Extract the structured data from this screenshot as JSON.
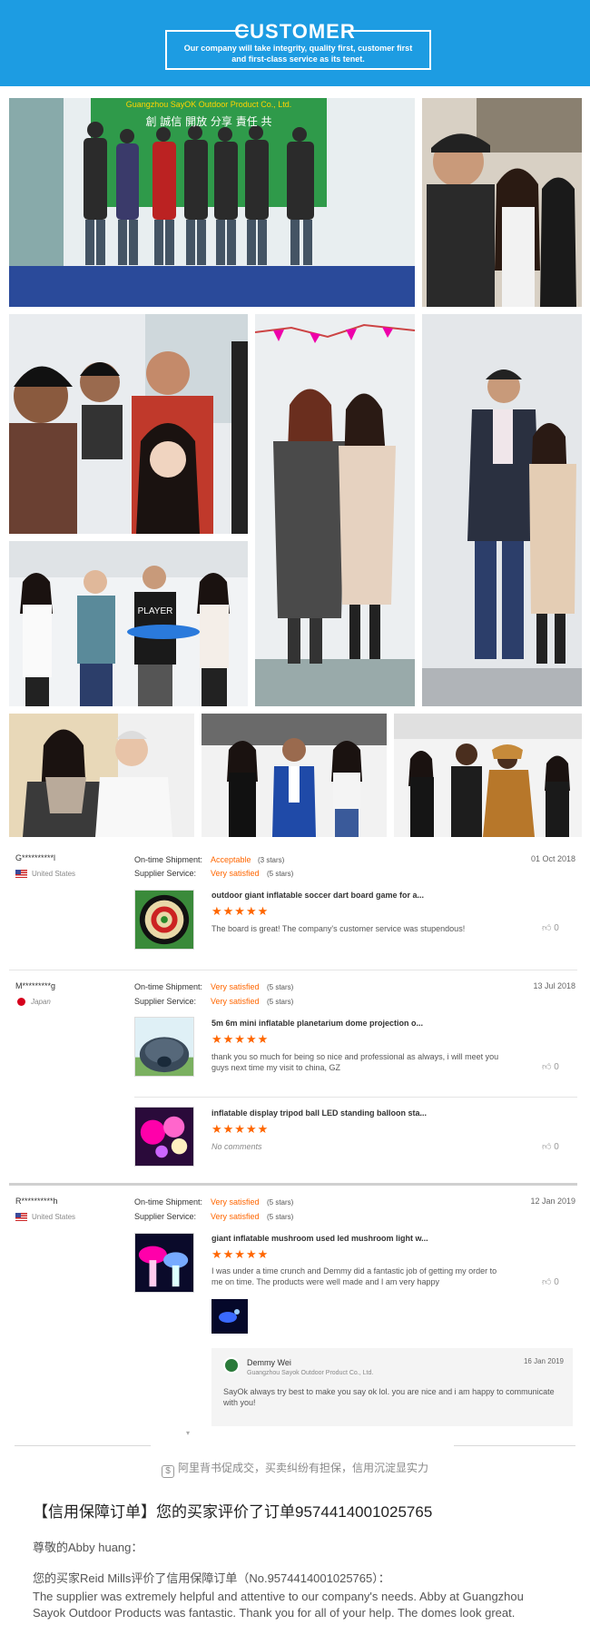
{
  "header": {
    "title": "CUSTOMER",
    "subtitle": "Our company will take integrity, quality first, customer first and first-class service as its tenet."
  },
  "photos": {
    "banner_text": "Guangzhou SayOK Outdoor Product Co., Ltd.",
    "wall_text": "創 誠信 開放 分享 責任 共",
    "shirt_text": "PLAYER"
  },
  "reviews": [
    {
      "buyer": "G**********l",
      "country": "United States",
      "shipment_label": "On-time Shipment:",
      "shipment_value": "Acceptable",
      "shipment_stars": "(3 stars)",
      "service_label": "Supplier Service:",
      "service_value": "Very satisfied",
      "service_stars": "(5 stars)",
      "date": "01 Oct 2018",
      "items": [
        {
          "title": "outdoor giant inflatable soccer dart board game for a...",
          "stars": "★★★★★",
          "comment": "The board is great! The company's customer service was stupendous!",
          "likes": "0"
        }
      ]
    },
    {
      "buyer": "M*********g",
      "country": "Japan",
      "shipment_label": "On-time Shipment:",
      "shipment_value": "Very satisfied",
      "shipment_stars": "(5 stars)",
      "service_label": "Supplier Service:",
      "service_value": "Very satisfied",
      "service_stars": "(5 stars)",
      "date": "13 Jul 2018",
      "items": [
        {
          "title": "5m 6m mini inflatable planetarium dome projection o...",
          "stars": "★★★★★",
          "comment": "thank you so much for being so nice and professional as always, i will meet you guys next time my visit to china, GZ",
          "likes": "0"
        },
        {
          "title": "inflatable display tripod ball LED standing balloon sta...",
          "stars": "★★★★★",
          "comment": "No comments",
          "likes": "0"
        }
      ]
    },
    {
      "buyer": "R**********h",
      "country": "United States",
      "shipment_label": "On-time Shipment:",
      "shipment_value": "Very satisfied",
      "shipment_stars": "(5 stars)",
      "service_label": "Supplier Service:",
      "service_value": "Very satisfied",
      "service_stars": "(5 stars)",
      "date": "12 Jan 2019",
      "items": [
        {
          "title": "giant inflatable mushroom used led mushroom light w...",
          "stars": "★★★★★",
          "comment": "I was under a time crunch and Demmy did a fantastic job of getting my order to me on time. The products were well made and I am very happy",
          "likes": "0"
        }
      ],
      "reply": {
        "name": "Demmy Wei",
        "company": "Guangzhou Sayok Outdoor Product Co., Ltd.",
        "date": "16 Jan 2019",
        "text": "SayOk always try best to make you say ok lol.  you are nice and i am happy to communicate with you!"
      }
    }
  ],
  "bottom": {
    "ali_note": "阿里背书促成交，买卖纠纷有担保，信用沉淀显实力",
    "order_title": "【信用保障订单】您的买家评价了订单9574414001025765",
    "greeting": "尊敬的Abby huang：",
    "buyer_line": "您的买家Reid Mills评价了信用保障订单（No.9574414001025765）：",
    "english": "The supplier was extremely helpful and attentive to our company's needs. Abby at Guangzhou Sayok Outdoor Products was fantastic. Thank you for all of your help. The domes look great."
  },
  "colors": {
    "header_bg": "#1d9ce2",
    "accent_orange": "#ff6600"
  }
}
